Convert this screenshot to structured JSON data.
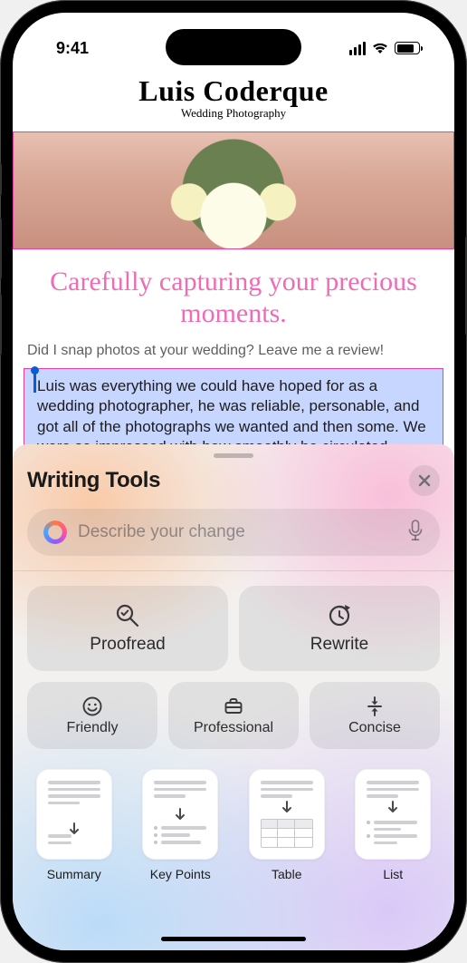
{
  "status": {
    "time": "9:41"
  },
  "page": {
    "name": "Luis Coderque",
    "subtitle": "Wedding Photography",
    "headline": "Carefully capturing your precious moments.",
    "prompt": "Did I snap photos at your wedding? Leave me a review!",
    "selection": "Luis was everything we could have hoped for as a wedding photographer, he was reliable, personable, and got all of the photographs we wanted and then some. We were so impressed with how smoothly he circulated through our ceremony and reception. We barely realized he was there except when he was very"
  },
  "sheet": {
    "title": "Writing Tools",
    "placeholder": "Describe your change",
    "proofread": "Proofread",
    "rewrite": "Rewrite",
    "friendly": "Friendly",
    "professional": "Professional",
    "concise": "Concise",
    "summary": "Summary",
    "keypoints": "Key Points",
    "table": "Table",
    "list": "List"
  }
}
